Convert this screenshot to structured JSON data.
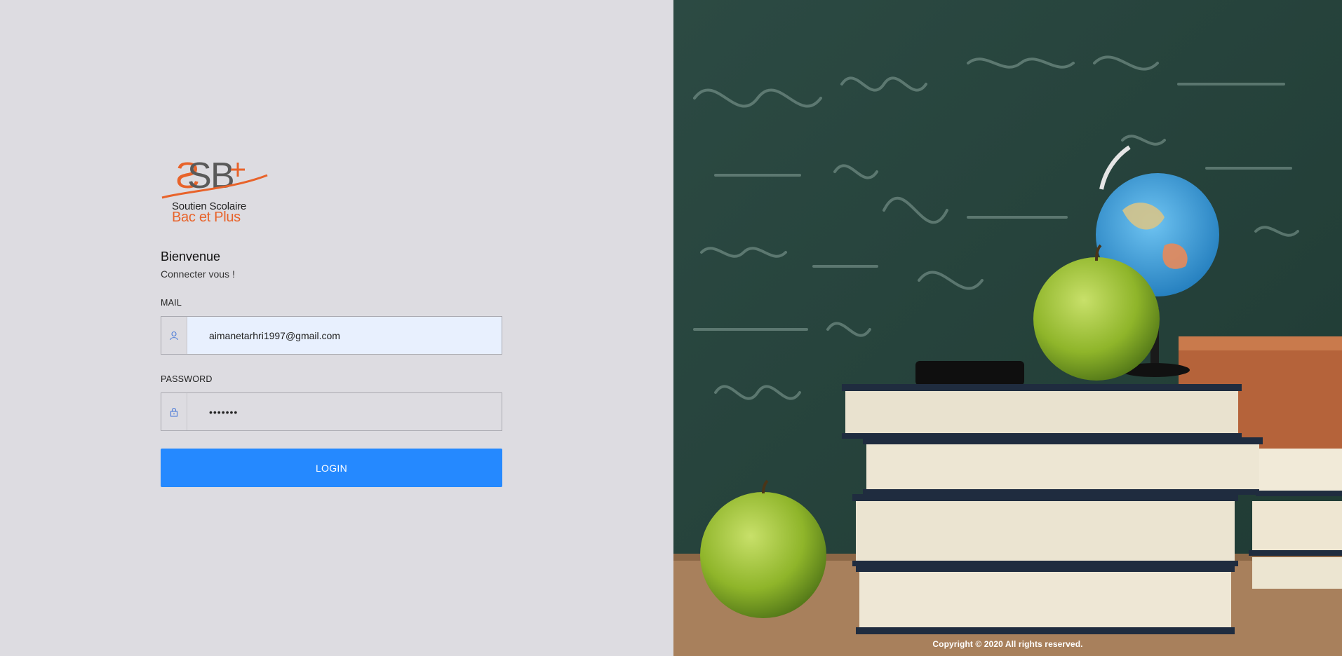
{
  "brand": {
    "logo_mark": "SSB+",
    "line1": "Soutien Scolaire",
    "line2": "Bac et Plus",
    "orange": "#e8632a",
    "grey": "#5a5a5a"
  },
  "form": {
    "title": "Bienvenue",
    "subtitle": "Connecter vous !",
    "mail_label": "MAIL",
    "mail_value": "aimanetarhri1997@gmail.com",
    "password_label": "PASSWORD",
    "password_value": "•••••••",
    "login_label": "LOGIN",
    "icons": {
      "mail": "user-icon",
      "password": "lock-icon"
    }
  },
  "colors": {
    "accent": "#2589ff",
    "left_bg": "#dddce1"
  },
  "footer": {
    "copyright": "Copyright © 2020 All rights reserved."
  }
}
